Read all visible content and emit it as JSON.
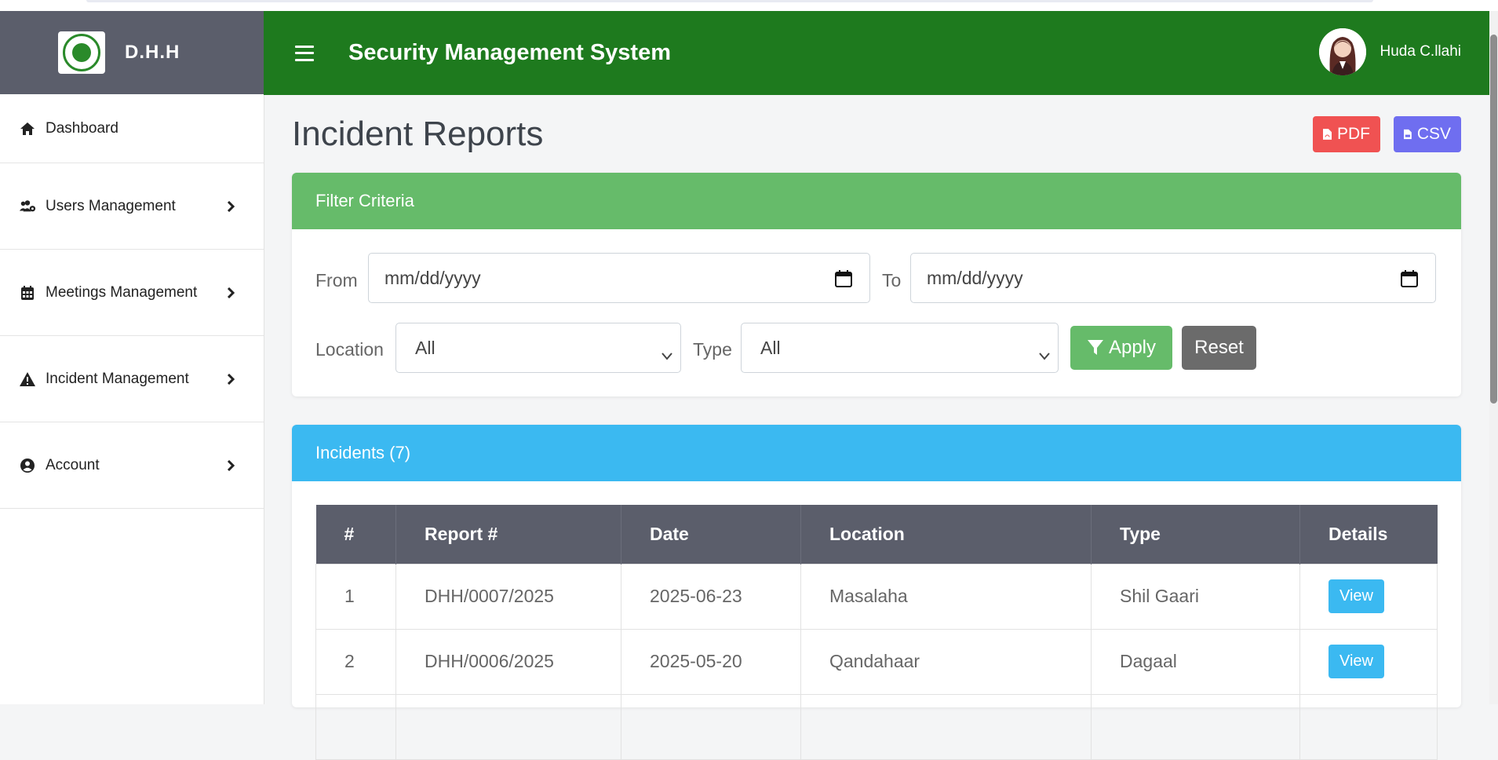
{
  "brand": {
    "name": "D.H.H"
  },
  "header": {
    "title": "Security Management System",
    "user_name": "Huda C.llahi"
  },
  "sidebar": {
    "items": [
      {
        "label": "Dashboard",
        "icon": "home-icon"
      },
      {
        "label": "Users Management",
        "icon": "users-cog-icon"
      },
      {
        "label": "Meetings Management",
        "icon": "calendar-icon"
      },
      {
        "label": "Incident Management",
        "icon": "warning-icon"
      },
      {
        "label": "Account",
        "icon": "user-circle-icon"
      }
    ]
  },
  "page": {
    "title": "Incident Reports",
    "pdf_label": "PDF",
    "csv_label": "CSV"
  },
  "filter": {
    "heading": "Filter Criteria",
    "from_label": "From",
    "from_value": "mm/dd/yyyy",
    "to_label": "To",
    "to_value": "mm/dd/yyyy",
    "location_label": "Location",
    "location_value": "All",
    "type_label": "Type",
    "type_value": "All",
    "apply_label": "Apply",
    "reset_label": "Reset"
  },
  "incidents": {
    "heading": "Incidents (7)",
    "columns": [
      "#",
      "Report #",
      "Date",
      "Location",
      "Type",
      "Details"
    ],
    "rows": [
      {
        "num": "1",
        "report": "DHH/0007/2025",
        "date": "2025-06-23",
        "location": "Masalaha",
        "type": "Shil Gaari",
        "action": "View"
      },
      {
        "num": "2",
        "report": "DHH/0006/2025",
        "date": "2025-05-20",
        "location": "Qandahaar",
        "type": "Dagaal",
        "action": "View"
      }
    ]
  },
  "colors": {
    "header_green": "#1e7a1e",
    "sidebar_dark": "#5b5e6b",
    "filter_green": "#66bb6a",
    "incidents_blue": "#3bb9f1",
    "pdf_red": "#f05252",
    "csv_purple": "#6f6ef0"
  }
}
